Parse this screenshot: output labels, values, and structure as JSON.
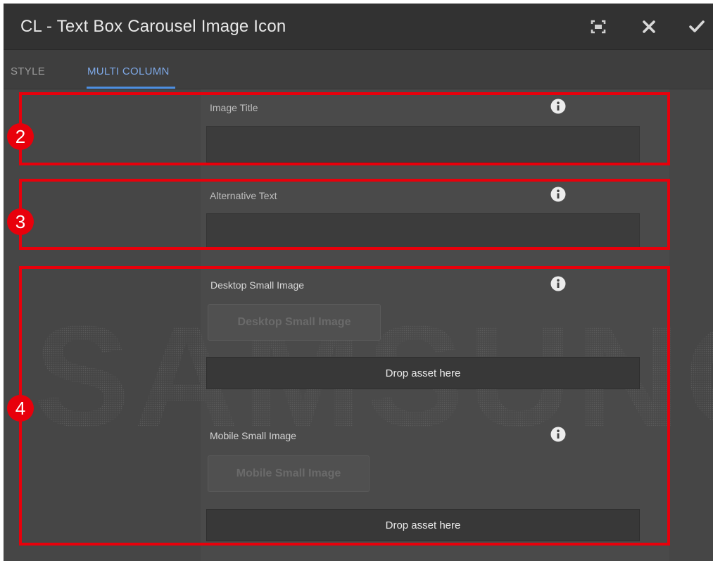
{
  "dialog": {
    "title": "CL - Text Box Carousel Image Icon",
    "buttons": {
      "fullscreen_icon": "fullscreen-icon",
      "close_icon": "close-icon",
      "done_icon": "checkmark-icon"
    }
  },
  "tabs": [
    {
      "label": "STYLE",
      "selected": false
    },
    {
      "label": "MULTI COLUMN",
      "selected": true
    }
  ],
  "fields": {
    "image_title": {
      "label": "Image Title",
      "value": ""
    },
    "alt_text": {
      "label": "Alternative Text",
      "value": ""
    },
    "desktop_small_image": {
      "label": "Desktop Small Image",
      "button_label": "Desktop Small Image",
      "drop_label": "Drop asset here"
    },
    "mobile_small_image": {
      "label": "Mobile Small Image",
      "button_label": "Mobile Small Image",
      "drop_label": "Drop asset here"
    }
  },
  "watermark_text": "SAMSUNG",
  "annotations": [
    {
      "number": "2"
    },
    {
      "number": "3"
    },
    {
      "number": "4"
    }
  ],
  "colors": {
    "accent": "#4d8fe1",
    "annotation_red": "#e8000b",
    "dialog_bg": "#464646",
    "titlebar_bg": "#323232"
  }
}
